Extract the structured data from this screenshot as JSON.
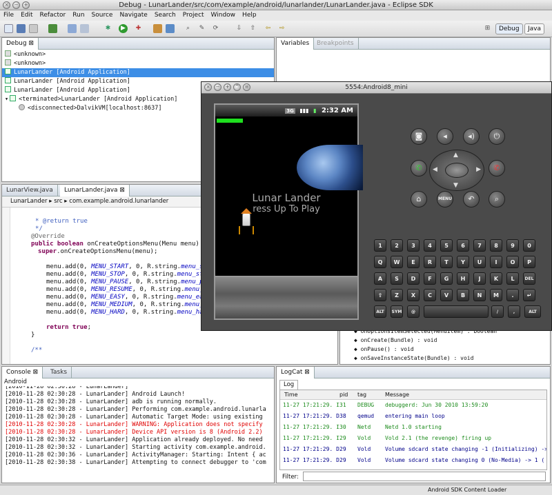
{
  "window": {
    "title": "Debug - LunarLander/src/com/example/android/lunarlander/LunarLander.java - Eclipse SDK"
  },
  "menu": [
    "File",
    "Edit",
    "Refactor",
    "Run",
    "Source",
    "Navigate",
    "Search",
    "Project",
    "Window",
    "Help"
  ],
  "perspectives": {
    "debug": "Debug",
    "java": "Java"
  },
  "debug_view": {
    "tab": "Debug",
    "rows": [
      "<unknown>",
      "<unknown>",
      "LunarLander [Android Application]",
      "LunarLander [Android Application]",
      "LunarLander [Android Application]",
      "<terminated>LunarLander [Android Application]",
      "<disconnected>DalvikVM[localhost:8637]"
    ]
  },
  "variables_view": {
    "tab_variables": "Variables",
    "tab_breakpoints": "Breakpoints"
  },
  "editor": {
    "tab1": "LunarView.java",
    "tab2": "LunarLander.java",
    "breadcrumb": [
      "LunarLander",
      "src",
      "com.example.android.lunarlander"
    ],
    "lines": {
      "l1": " * @return true",
      "l2": " */",
      "l3": "@Override",
      "l4a": "public boolean",
      "l4b": " onCreateOptionsMenu(Menu menu) {",
      "l5a": "super",
      "l5b": ".onCreateOptionsMenu(menu);",
      "m1": "MENU_START",
      "m2": "MENU_STOP",
      "m3": "MENU_PAUSE",
      "m4": "MENU_RESUME",
      "m5": "MENU_EASY",
      "m6": "MENU_MEDIUM",
      "m7": "MENU_HARD",
      "s1": "menu_sta",
      "s2": "menu_stop",
      "s3": "menu_pau",
      "s4": "menu_re",
      "s5": "menu_easy",
      "s6": "menu_me",
      "s7": "menu_hard",
      "add_prefix": "menu.add(0, ",
      "mid": ", 0, R.string.",
      "ret_kw": "return true",
      "ret_end": ";",
      "close": "}",
      "javadoc": "/**"
    }
  },
  "outline": {
    "items": [
      "onOptionsItemSelected(MenuItem) : boolean",
      "onCreate(Bundle) : void",
      "onPause() : void",
      "onSaveInstanceState(Bundle) : void"
    ]
  },
  "console": {
    "tab_console": "Console",
    "tab_tasks": "Tasks",
    "header": "Android",
    "lines": [
      {
        "text": "[2010-11-28 02:30:28 - LunarLander]",
        "red": false
      },
      {
        "text": "[2010-11-28 02:30:28 - LunarLander] Android Launch!",
        "red": false
      },
      {
        "text": "[2010-11-28 02:30:28 - LunarLander] adb is running normally.",
        "red": false
      },
      {
        "text": "[2010-11-28 02:30:28 - LunarLander] Performing com.example.android.lunarla",
        "red": false
      },
      {
        "text": "[2010-11-28 02:30:28 - LunarLander] Automatic Target Mode: using existing",
        "red": false
      },
      {
        "text": "[2010-11-28 02:30:28 - LunarLander] WARNING: Application does not specify",
        "red": true
      },
      {
        "text": "[2010-11-28 02:30:28 - LunarLander] Device API version is 8 (Android 2.2)",
        "red": true
      },
      {
        "text": "[2010-11-28 02:30:32 - LunarLander] Application already deployed. No need",
        "red": false
      },
      {
        "text": "[2010-11-28 02:30:32 - LunarLander] Starting activity com.example.android.",
        "red": false
      },
      {
        "text": "[2010-11-28 02:30:36 - LunarLander] ActivityManager: Starting: Intent { ac",
        "red": false
      },
      {
        "text": "[2010-11-28 02:30:38 - LunarLander] Attempting to connect debugger to 'com",
        "red": false
      }
    ]
  },
  "logcat": {
    "tab": "LogCat",
    "subtab": "Log",
    "headers": {
      "time": "Time",
      "pid": "pid",
      "tag": "tag",
      "message": "Message"
    },
    "rows": [
      {
        "time": "11-27 17:21:29. I",
        "pid": "31",
        "tag": "DEBUG",
        "msg": "debuggerd: Jun 30 2010 13:59:20",
        "color": "green"
      },
      {
        "time": "11-27 17:21:29. D",
        "pid": "38",
        "tag": "qemud",
        "msg": "entering main loop",
        "color": "blue"
      },
      {
        "time": "11-27 17:21:29. I",
        "pid": "30",
        "tag": "Netd",
        "msg": "Netd 1.0 starting",
        "color": "green"
      },
      {
        "time": "11-27 17:21:29. I",
        "pid": "29",
        "tag": "Vold",
        "msg": "Vold 2.1 (the revenge) firing up",
        "color": "green"
      },
      {
        "time": "11-27 17:21:29. D",
        "pid": "29",
        "tag": "Vold",
        "msg": "Volume sdcard state changing -1 (Initializing) ->",
        "color": "blue"
      },
      {
        "time": "11-27 17:21:29. D",
        "pid": "29",
        "tag": "Vold",
        "msg": "Volume sdcard state changing 0 (No-Media) -> 1 (",
        "color": "blue"
      }
    ],
    "filter_label": "Filter:"
  },
  "emulator": {
    "title": "5554:Android8_mini",
    "clock": "2:32 AM",
    "game_title": "Lunar Lander",
    "game_sub": "ress Up To Play",
    "menu_label": "MENU",
    "keys_row1": [
      "1",
      "2",
      "3",
      "4",
      "5",
      "6",
      "7",
      "8",
      "9",
      "0"
    ],
    "keys_row2": [
      "Q",
      "W",
      "E",
      "R",
      "T",
      "Y",
      "U",
      "I",
      "O",
      "P"
    ],
    "keys_row3": [
      "A",
      "S",
      "D",
      "F",
      "G",
      "H",
      "J",
      "K",
      "L",
      "DEL"
    ],
    "keys_row4": [
      "⇧",
      "Z",
      "X",
      "C",
      "V",
      "B",
      "N",
      "M",
      ".",
      "↵"
    ],
    "alt": "ALT",
    "sym": "SYM",
    "at": "@",
    "slash": "/",
    "comma": ",",
    "alt2": "ALT"
  },
  "status": {
    "loader": "Android SDK Content Loader"
  },
  "colors": {
    "selection": "#3d8ee6",
    "warning": "#e00000",
    "keyword": "#7f0055"
  }
}
